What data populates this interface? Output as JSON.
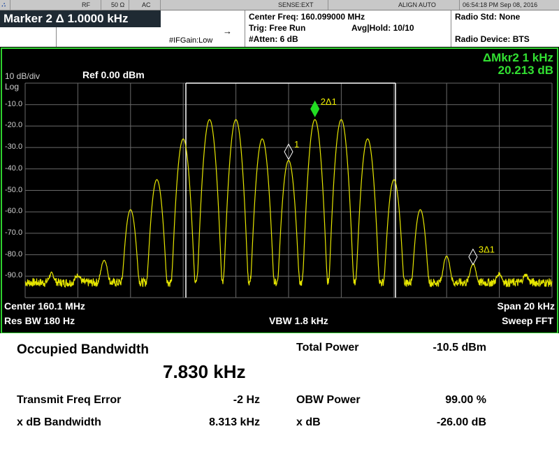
{
  "status_bar": {
    "rf": "RF",
    "impedance": "50 Ω",
    "coupling": "AC",
    "sense": "SENSE:EXT",
    "align": "ALIGN AUTO",
    "datetime": "06:54:18 PM Sep 08, 2016"
  },
  "header": {
    "marker_title": "Marker 2 Δ  1.0000 kHz",
    "ifgain": "#IFGain:Low",
    "center_freq": "Center Freq: 160.099000 MHz",
    "trig": "Trig: Free Run",
    "avg_hold": "Avg|Hold: 10/10",
    "atten": "#Atten: 6 dB",
    "radio_std": "Radio Std: None",
    "radio_device": "Radio Device: BTS"
  },
  "plot": {
    "scale": "10 dB/div",
    "log": "Log",
    "ref": "Ref 0.00 dBm",
    "delta_marker_label": "ΔMkr2  1 kHz",
    "delta_marker_value": "20.213 dB",
    "y_ticks": [
      "-10.0",
      "-20.0",
      "-30.0",
      "-40.0",
      "-50.0",
      "-60.0",
      "-70.0",
      "-80.0",
      "-90.0"
    ],
    "center": "Center  160.1 MHz",
    "res_bw": "Res BW  180 Hz",
    "vbw": "VBW  1.8 kHz",
    "span": "Span 20 kHz",
    "sweep": "Sweep FFT",
    "markers": [
      {
        "label": "1",
        "x_khz": 0.0,
        "level_dbm": -32
      },
      {
        "label": "2Δ1",
        "x_khz": 1.0,
        "level_dbm": -12
      },
      {
        "label": "3Δ1",
        "x_khz": 7.0,
        "level_dbm": -81
      }
    ],
    "trace_color": "#e6e600"
  },
  "chart_data": {
    "type": "line",
    "x_unit": "kHz offset from center",
    "x_range": [
      -10,
      10
    ],
    "ylim": [
      -100,
      0
    ],
    "grid": true,
    "series": [
      {
        "x": [
          -9.0,
          -8.0,
          -7.0,
          -6.0,
          -5.0,
          -4.0,
          -3.0,
          -2.0,
          -1.0,
          0.0,
          1.0,
          2.0,
          3.0,
          4.0,
          5.0,
          6.0,
          7.0,
          8.0,
          9.0
        ],
        "values": [
          -91,
          -92,
          -83,
          -59,
          -45,
          -26,
          -17,
          -17,
          -26,
          -36,
          -17,
          -17,
          -26,
          -45,
          -59,
          -81,
          -85,
          -91,
          -92
        ]
      }
    ]
  },
  "results": {
    "obw_title": "Occupied Bandwidth",
    "obw_value": "7.830 kHz",
    "tfe_label": "Transmit Freq Error",
    "tfe_value": "-2 Hz",
    "xdb_bw_label": "x dB Bandwidth",
    "xdb_bw_value": "8.313 kHz",
    "total_power_label": "Total Power",
    "total_power_value": "-10.5 dBm",
    "obw_power_label": "OBW Power",
    "obw_power_value": "99.00 %",
    "xdb_label": "x dB",
    "xdb_value": "-26.00 dB"
  }
}
